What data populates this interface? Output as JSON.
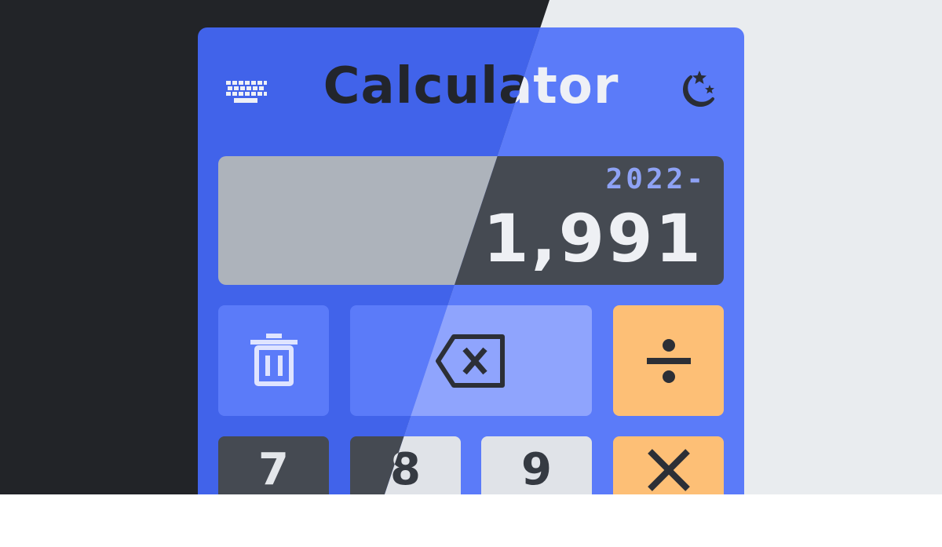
{
  "app": {
    "title": "Calculator",
    "theme_colors": {
      "card_dark": "#4163ea",
      "card_light": "#5b7bf9",
      "operator": "#fdbf76",
      "expression_text": "#8ea2f5"
    }
  },
  "header": {
    "keyboard_icon": "keyboard-icon",
    "theme_toggle_icon": "moon-stars-icon"
  },
  "display": {
    "expression": "2022-",
    "result": "1,991"
  },
  "keys": {
    "clear_icon": "trash-icon",
    "backspace_icon": "backspace-icon",
    "divide_icon": "divide-icon",
    "multiply_icon": "multiply-icon",
    "digits": [
      "7",
      "8",
      "9"
    ]
  }
}
